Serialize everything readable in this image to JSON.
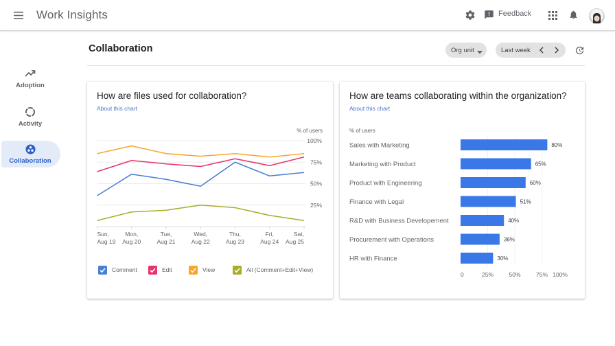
{
  "header": {
    "title": "Work Insights",
    "feedback_label": "Feedback",
    "icons": [
      "menu-icon",
      "settings-gear-icon",
      "feedback-icon",
      "apps-grid-icon",
      "notifications-bell-icon",
      "avatar"
    ]
  },
  "sidebar": {
    "items": [
      {
        "label": "Adoption",
        "icon": "trending-up-icon",
        "active": false
      },
      {
        "label": "Activity",
        "icon": "activity-ring-icon",
        "active": false
      },
      {
        "label": "Collaboration",
        "icon": "collaboration-icon",
        "active": true
      }
    ]
  },
  "page": {
    "title": "Collaboration",
    "filters": {
      "org_unit": "Org unit",
      "period": "Last week"
    }
  },
  "colors": {
    "accent": "#2d5fc4",
    "active_nav_bg": "#e3ebf9",
    "bar": "#3b78e7",
    "link": "#4a74c9"
  },
  "chart_data": [
    {
      "type": "line",
      "title": "How are files used for collaboration?",
      "link": "About this chart",
      "ylabel": "% of users",
      "xlabel": "",
      "ylim": [
        0,
        100
      ],
      "yticks": [
        {
          "value": 100,
          "label": "100%"
        },
        {
          "value": 75,
          "label": "75%"
        },
        {
          "value": 50,
          "label": "50%"
        },
        {
          "value": 25,
          "label": "25%"
        }
      ],
      "grid": true,
      "legend": "bottom",
      "categories": [
        "Sun, Aug 19",
        "Mon, Aug 20",
        "Tue, Aug 21",
        "Wed, Aug 22",
        "Thu, Aug 23",
        "Fri, Aug 24",
        "Sat, Aug 25"
      ],
      "series": [
        {
          "name": "Comment",
          "color": "#4a7fd6",
          "checked": true,
          "values": [
            36,
            61,
            55,
            47,
            75,
            59,
            63
          ]
        },
        {
          "name": "Edit",
          "color": "#e8336b",
          "checked": true,
          "values": [
            64,
            77,
            73,
            70,
            79,
            71,
            81
          ]
        },
        {
          "name": "View",
          "color": "#f9a62b",
          "checked": true,
          "values": [
            85,
            94,
            85,
            82,
            85,
            81,
            85
          ]
        },
        {
          "name": "All (Comment+Edit+View)",
          "color": "#a9ad2c",
          "checked": true,
          "values": [
            7,
            17,
            19,
            25,
            22,
            13,
            7
          ]
        }
      ]
    },
    {
      "type": "bar",
      "orientation": "horizontal",
      "title": "How are teams collaborating within the organization?",
      "link": "About this chart",
      "ylabel": "% of users",
      "xlabel": "",
      "xlim": [
        0,
        100
      ],
      "xticks": [
        {
          "value": 0,
          "label": "0"
        },
        {
          "value": 25,
          "label": "25%"
        },
        {
          "value": 50,
          "label": "50%"
        },
        {
          "value": 75,
          "label": "75%"
        },
        {
          "value": 100,
          "label": "100%"
        }
      ],
      "grid": true,
      "color": "#3b78e7",
      "categories": [
        "Sales with Marketing",
        "Marketing with Product",
        "Product with Engineering",
        "Finance with Legal",
        "R&D with Business Developement",
        "Procurement with Operations",
        "HR with Finance"
      ],
      "values": [
        80,
        65,
        60,
        51,
        40,
        36,
        30
      ],
      "value_labels": [
        "80%",
        "65%",
        "60%",
        "51%",
        "40%",
        "36%",
        "30%"
      ]
    }
  ]
}
